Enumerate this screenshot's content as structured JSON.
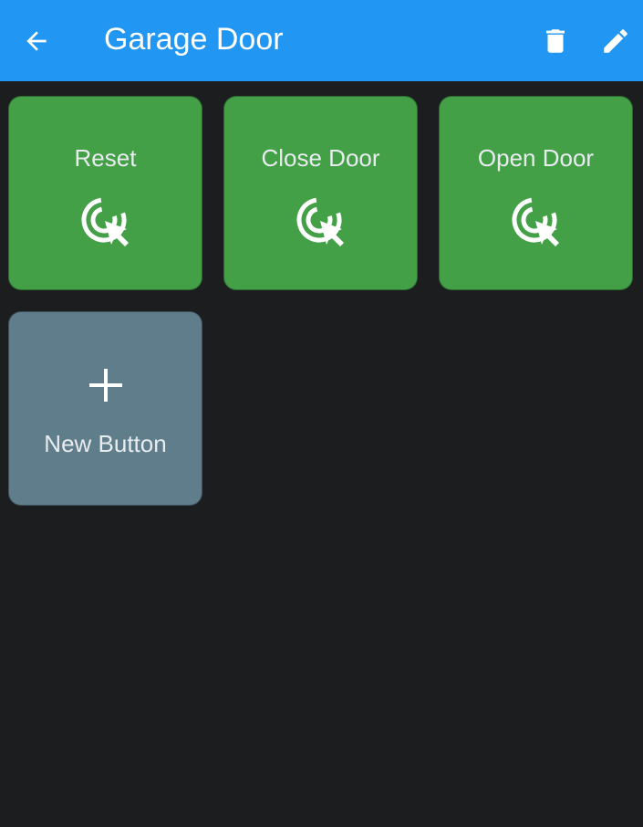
{
  "appbar": {
    "title": "Garage Door",
    "back_icon": "arrow-left-icon",
    "delete_icon": "trash-icon",
    "edit_icon": "pencil-icon",
    "background": "#2196f3"
  },
  "buttons": [
    {
      "label": "Reset",
      "icon": "tap-cursor-icon",
      "color": "#43a047"
    },
    {
      "label": "Close Door",
      "icon": "tap-cursor-icon",
      "color": "#43a047"
    },
    {
      "label": "Open Door",
      "icon": "tap-cursor-icon",
      "color": "#43a047"
    }
  ],
  "new_button": {
    "label": "New Button",
    "icon": "plus-icon",
    "color": "#607d8b"
  },
  "theme": {
    "page_background": "#1c1d1f"
  }
}
